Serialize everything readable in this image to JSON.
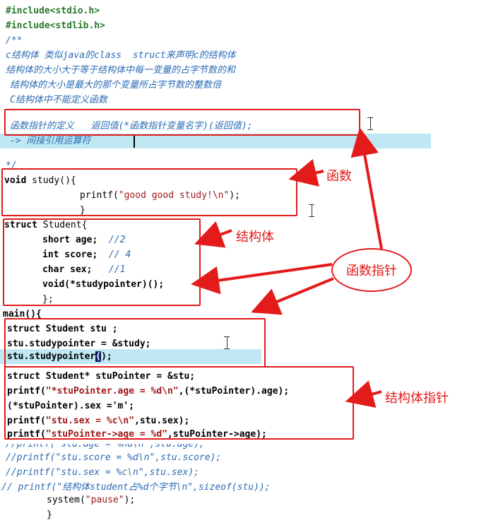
{
  "code": {
    "l1": "#include<stdio.h>",
    "l2": "#include<stdlib.h>",
    "l3": "/**",
    "l4": "c结构体 类似java的class  struct来声明c的结构体",
    "l5": "结构体的大小大于等于结构体中每一变量的占字节数的和",
    "l6": "结构体的大小是最大的那个变量所占字节数的整数倍",
    "l7": "C结构体中不能定义函数",
    "l8": "函数指针的定义   返回值(*函数指针变量名字)(返回值);",
    "l9": " -> 间接引用运算符",
    "l10": "*/",
    "void": "void",
    "study_sig": " study(){",
    "printf": "printf",
    "paren_open": "(",
    "paren_close_semi": ");",
    "good_study_str": "\"good good study!\\n\"",
    "brace_close": "}",
    "struct_kw": "struct",
    "student_open": " Student{",
    "short_age": "short age;  ",
    "c2": "//2",
    "int_score": "int score;  ",
    "c4": "// 4",
    "char_sex": "char sex;   ",
    "c1": "//1",
    "void_ptr": "void(*studypointer)();",
    "struct_close": "};",
    "main": "main(){",
    "stu_decl": "struct Student stu ;",
    "assign_ptr": "stu.studypointer = &study;",
    "call_ptr_a": "stu.studypointer",
    "call_ptr_paren": "(",
    "call_ptr_b": ");",
    "stupointer_decl": "struct Student* stuPointer = &stu;",
    "age_str": "\"*stuPointer.age = %d\\n\"",
    "age_args": ",(*stuPointer).age);",
    "set_sex": "(*stuPointer).sex ='m';",
    "sex_str": "\"stu.sex = %c\\n\"",
    "sex_args": ",stu.sex);",
    "arrow_str": "\"stuPointer->age = %d\"",
    "arrow_args": ",stuPointer->age);",
    "cl1": "//printf(\"stu.age = %hd\\n\",stu.age);",
    "cl2": "//printf(\"stu.score = %d\\n\",stu.score);",
    "cl3": "//printf(\"stu.sex = %c\\n\",stu.sex);",
    "cl4": "// printf(\"结构体student占%d个字节\\n\",sizeof(stu));",
    "system": "system",
    "pause_str": "\"pause\""
  },
  "annotations": {
    "function": "函数",
    "struct": "结构体",
    "function_pointer": "函数指针",
    "struct_pointer": "结构体指针"
  },
  "colors": {
    "annotation_red": "#e31b1b",
    "comment_blue": "#2b6bb3",
    "preprocessor_green": "#2a7a2a",
    "string_red": "#a01818",
    "line_highlight": "#bfe8f2"
  }
}
